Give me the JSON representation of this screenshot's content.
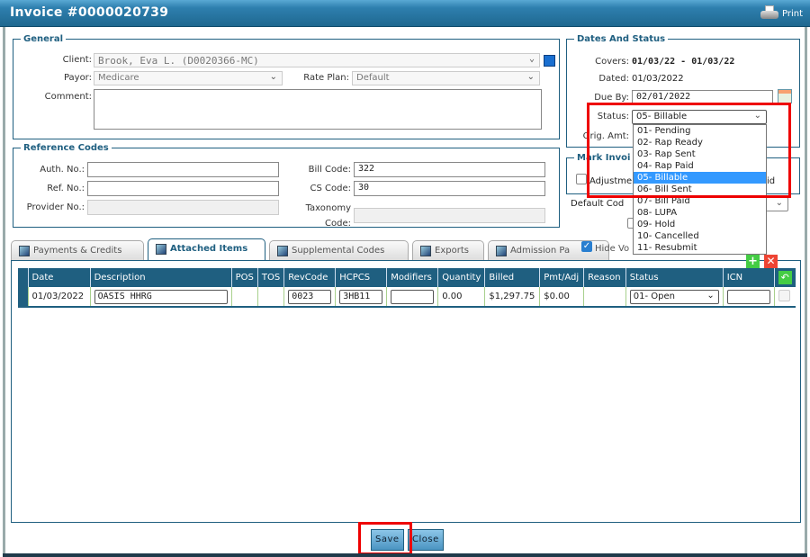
{
  "window": {
    "title": "Invoice #0000020739",
    "print_label": "Print"
  },
  "general": {
    "legend": "General",
    "client_label": "Client:",
    "client_value": "Brook, Eva L. (D0020366-MC)",
    "payor_label": "Payor:",
    "payor_value": "Medicare",
    "rate_plan_label": "Rate Plan:",
    "rate_plan_value": "Default",
    "comment_label": "Comment:",
    "comment_value": ""
  },
  "dates": {
    "legend": "Dates And Status",
    "covers_label": "Covers:",
    "covers_value": "01/03/22 - 01/03/22",
    "dated_label": "Dated:",
    "dated_value": "01/03/2022",
    "due_label": "Due By:",
    "due_value": "02/01/2022",
    "status_label": "Status:",
    "status_value": "05- Billable",
    "orig_label": "Orig. Amt:"
  },
  "status_options": [
    "01- Pending",
    "02- Rap Ready",
    "03- Rap Sent",
    "04- Rap Paid",
    "05- Billable",
    "06- Bill Sent",
    "07- Bill Paid",
    "08- LUPA",
    "09- Hold",
    "10- Cancelled",
    "11- Resubmit"
  ],
  "mark_invoice": {
    "legend": "Mark Invoi",
    "adjust_label": "Adjustme",
    "paid_label": "id",
    "default_code_label": "Default Cod"
  },
  "reference": {
    "legend": "Reference Codes",
    "auth_label": "Auth. No.:",
    "auth_value": "",
    "ref_label": "Ref. No.:",
    "ref_value": "",
    "provider_label": "Provider No.:",
    "provider_value": "",
    "bill_label": "Bill Code:",
    "bill_value": "322",
    "cs_label": "CS Code:",
    "cs_value": "30",
    "taxonomy_label1": "Taxonomy",
    "taxonomy_label2": "Code:",
    "taxonomy_value": ""
  },
  "tabs": [
    "Payments & Credits",
    "Attached Items",
    "Supplemental Codes",
    "Exports",
    "Admission Pa"
  ],
  "hide_label": "Hide Vo",
  "table": {
    "headers": [
      "",
      "Date",
      "Description",
      "POS",
      "TOS",
      "RevCode",
      "HCPCS",
      "Modifiers",
      "Quantity",
      "Billed",
      "Pmt/Adj",
      "Reason",
      "Status",
      "ICN",
      ""
    ],
    "row": {
      "date": "01/03/2022",
      "description": "OASIS HHRG",
      "pos": "",
      "tos": "",
      "revcode": "0023",
      "hcpcs": "3HB11",
      "modifiers": "",
      "quantity": "0.00",
      "billed": "$1,297.75",
      "pmtadj": "$0.00",
      "reason": "",
      "status": "01- Open",
      "icn": ""
    }
  },
  "buttons": {
    "save": "Save",
    "close": "Close"
  }
}
